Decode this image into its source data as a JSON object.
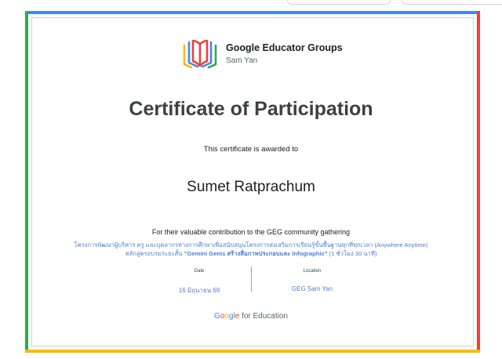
{
  "header": {
    "brand_name": "Google Educator Groups",
    "brand_sub": "Sam Yan"
  },
  "certificate": {
    "title": "Certificate of Participation",
    "awarded_text": "This certificate is awarded to",
    "recipient": "Sumet Ratprachum",
    "contribution": "For their valuable contribution to the GEG community gathering",
    "program_line1": "โครงการพัฒนาผู้บริหาร ครู และบุคลากรทางการศึกษาเพื่อสนับสนุนโครงการส่งเสริมการเรียนรู้ขั้นพื้นฐานทุกที่ทุกเวลา (Anywhere Anytime)",
    "program_line2_prefix": "หลักสูตรอบรมระยะสั้น",
    "program_line2_bold": "“Gemini Gems สร้างสื่อภาพประกอบและ Infographic”",
    "program_line2_suffix": "(1 ชั่วโมง 30 นาที)"
  },
  "details": {
    "date_label": "Date",
    "date_value": "16 มิถุนายน 69",
    "location_label": "Location",
    "location_value": "GEG Sam Yan"
  },
  "footer": {
    "google_letters": [
      "G",
      "o",
      "o",
      "g",
      "l",
      "e"
    ],
    "suffix": "for Education"
  },
  "colors": {
    "blue": "#4285f4",
    "red": "#ea4335",
    "yellow": "#fbbc04",
    "green": "#34a853",
    "link": "#4a7fd4"
  },
  "icons": {
    "brand_logo": "open-book-logo-icon"
  }
}
